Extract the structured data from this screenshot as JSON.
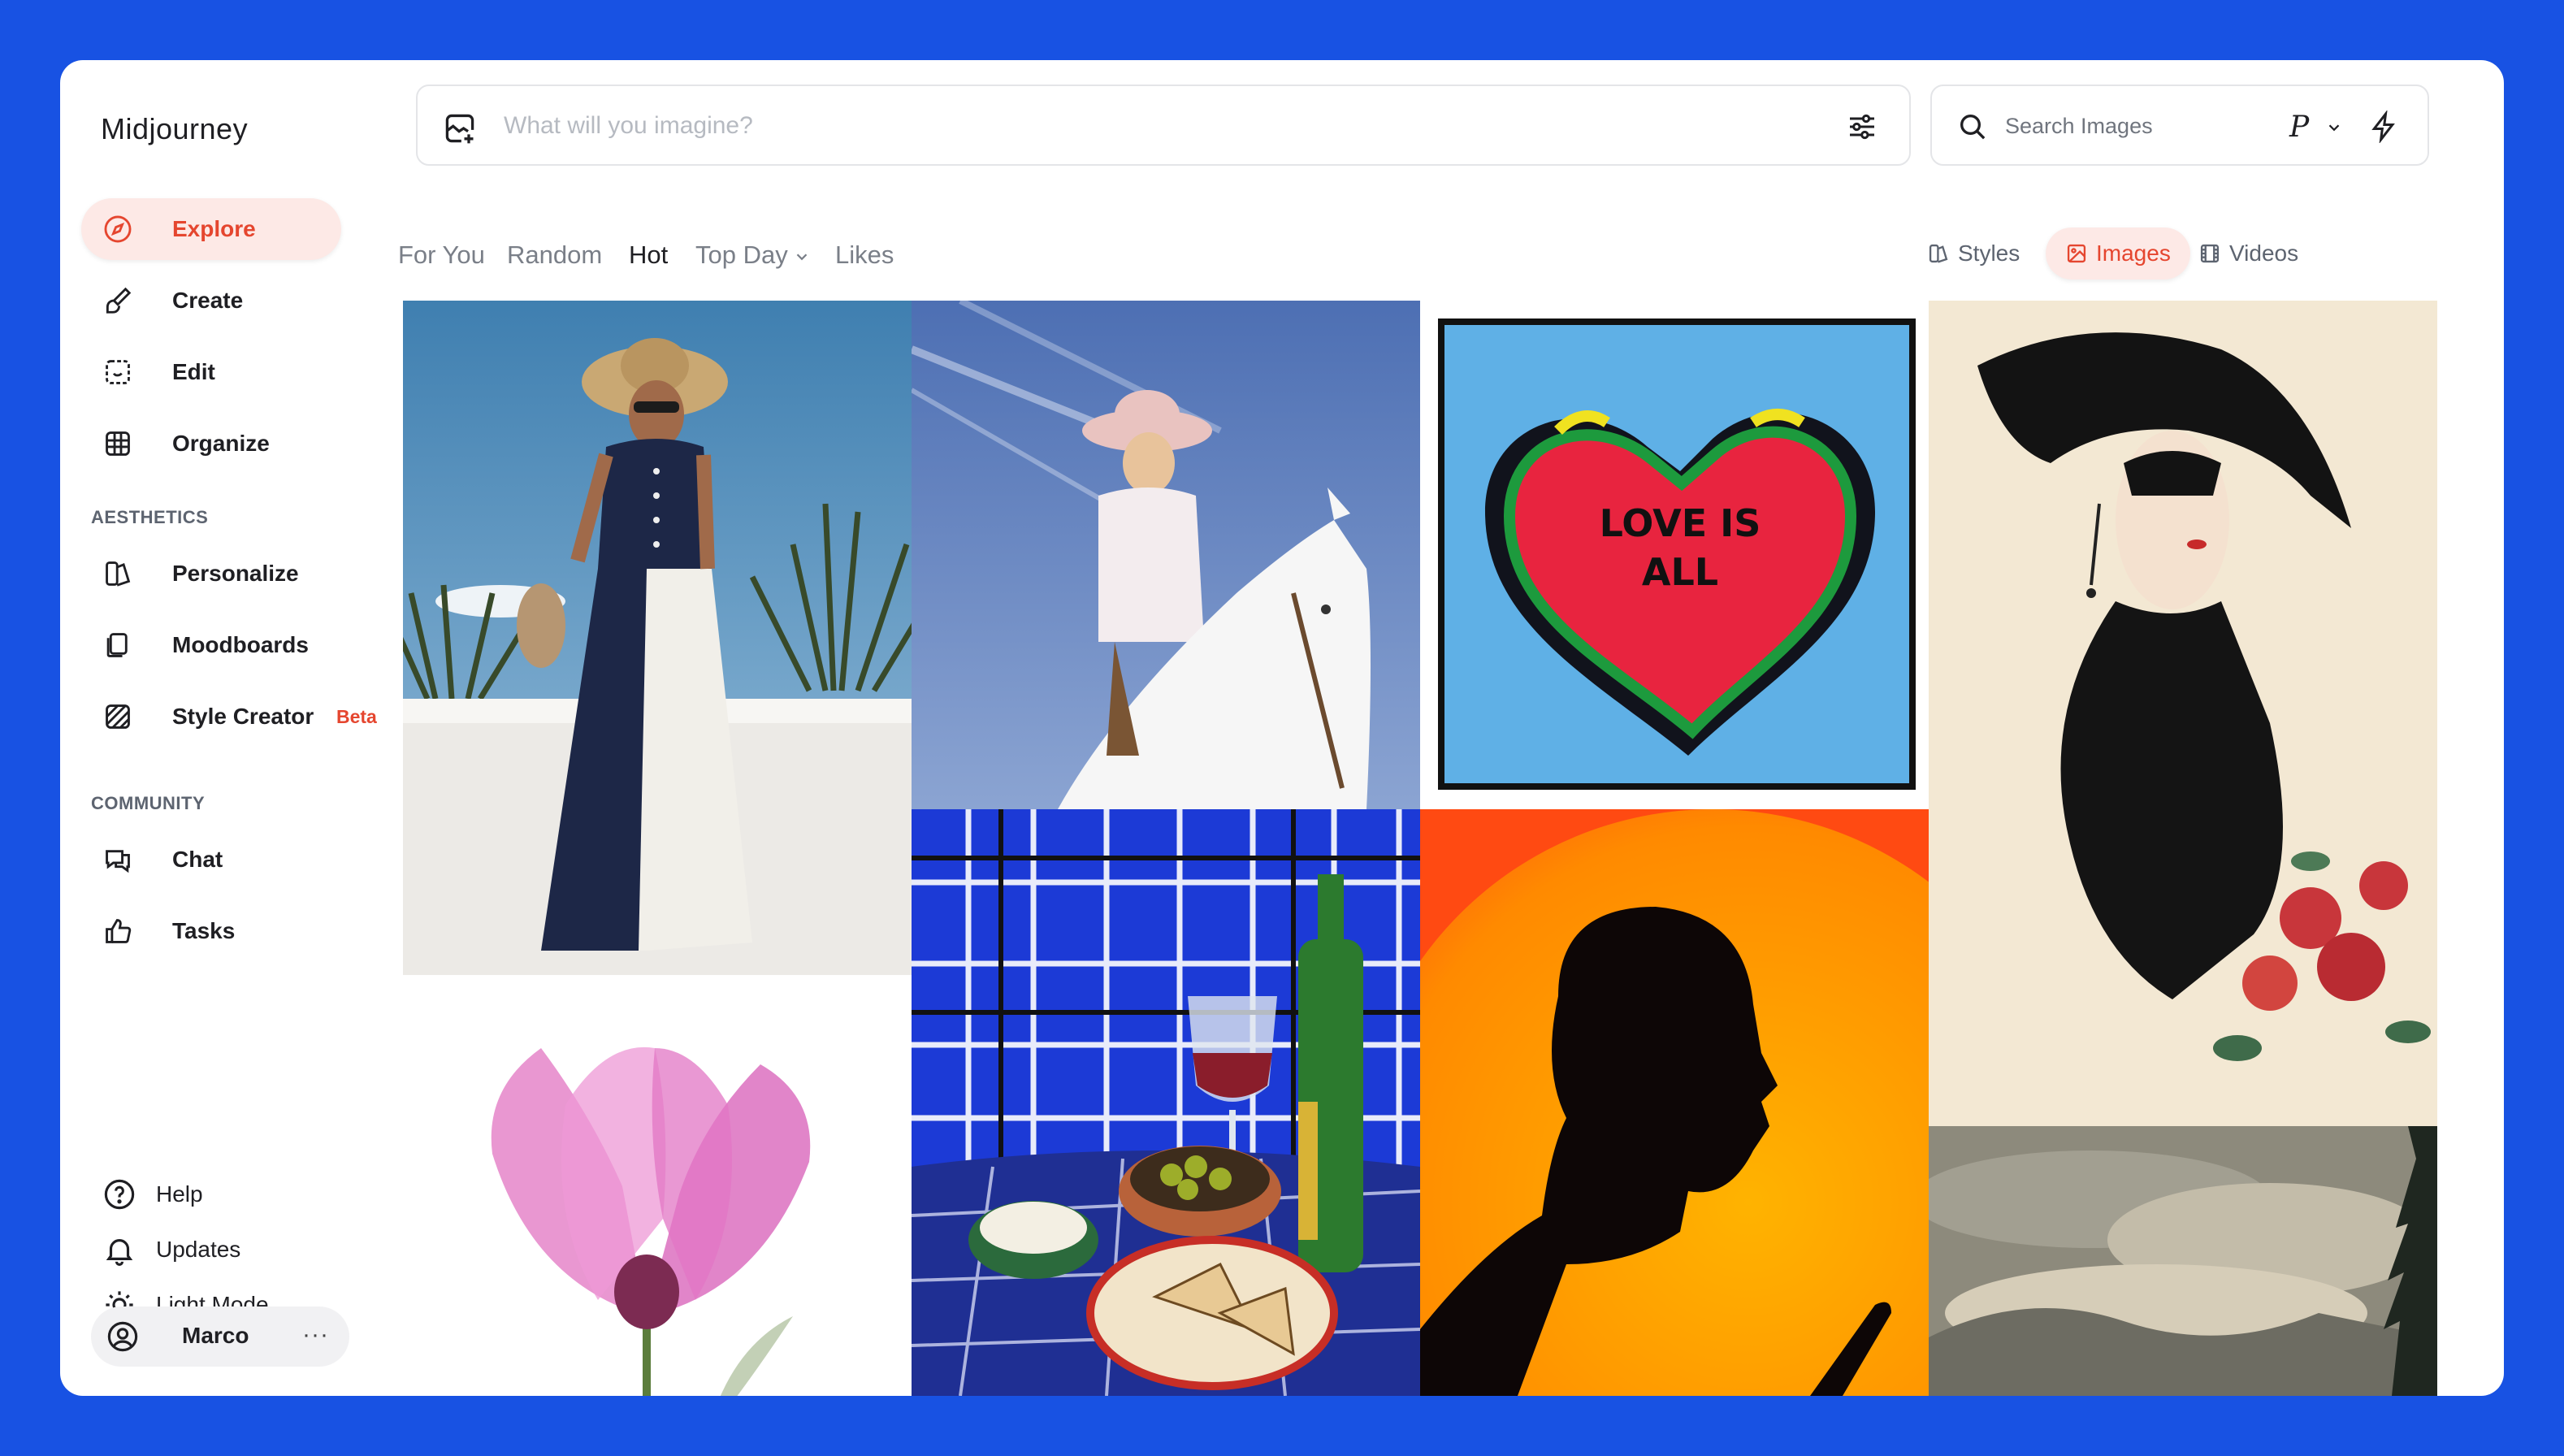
{
  "app": {
    "title": "Midjourney"
  },
  "sidebar": {
    "primary": [
      {
        "label": "Explore",
        "icon": "compass-icon",
        "active": true
      },
      {
        "label": "Create",
        "icon": "brush-icon"
      },
      {
        "label": "Edit",
        "icon": "edit-icon"
      },
      {
        "label": "Organize",
        "icon": "grid-icon"
      }
    ],
    "aesthetics_title": "AESTHETICS",
    "aesthetics": [
      {
        "label": "Personalize",
        "icon": "personalize-icon"
      },
      {
        "label": "Moodboards",
        "icon": "moodboards-icon"
      },
      {
        "label": "Style Creator",
        "icon": "style-creator-icon",
        "badge": "Beta"
      }
    ],
    "community_title": "COMMUNITY",
    "community": [
      {
        "label": "Chat",
        "icon": "chat-icon"
      },
      {
        "label": "Tasks",
        "icon": "thumbs-up-icon"
      }
    ],
    "bottom": [
      {
        "label": "Help",
        "icon": "help-icon"
      },
      {
        "label": "Updates",
        "icon": "bell-icon"
      },
      {
        "label": "Light Mode",
        "icon": "sun-icon"
      }
    ],
    "user": {
      "name": "Marco",
      "more": "···"
    }
  },
  "prompt": {
    "placeholder": "What will you imagine?"
  },
  "search": {
    "placeholder": "Search Images",
    "profile": "P"
  },
  "tabs": [
    "For You",
    "Random",
    "Hot",
    "Top Day",
    "Likes"
  ],
  "active_tab": "Hot",
  "views": [
    "Styles",
    "Images",
    "Videos"
  ],
  "active_view": "Images",
  "gallery": {
    "heart_text_1": "LOVE IS",
    "heart_text_2": "ALL"
  },
  "colors": {
    "accent": "#e5462f",
    "accent_bg": "#fde9e6",
    "frame": "#1852e3"
  }
}
